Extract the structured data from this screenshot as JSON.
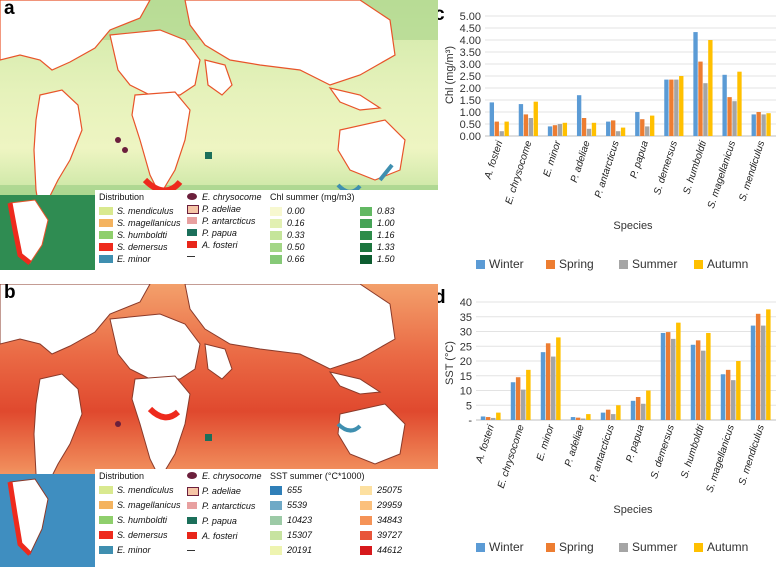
{
  "panels": {
    "a": "a",
    "b": "b",
    "c": "c",
    "d": "d"
  },
  "legend_a": {
    "distribution_title": "Distribution",
    "distribution": [
      {
        "label": "S. mendiculus",
        "color": "#d9e98f"
      },
      {
        "label": "S. magellanicus",
        "color": "#f4b35f"
      },
      {
        "label": "S. humboldti",
        "color": "#8fcf6c"
      },
      {
        "label": "S. demersus",
        "color": "#ee2a1d"
      },
      {
        "label": "E. minor",
        "color": "#3f8fb0"
      }
    ],
    "species2": [
      {
        "label": "E. chrysocome",
        "color": "#6b1f3c"
      },
      {
        "label": "P. adeliae",
        "color": "#f6c5a6"
      },
      {
        "label": "P. antarcticus",
        "color": "#e8a0a0"
      },
      {
        "label": "P. papua",
        "color": "#1b6f5a"
      },
      {
        "label": "A. fosteri",
        "color": "#e8261a"
      },
      {
        "label": "",
        "color": "#333333"
      }
    ],
    "scale_title": "Chl summer (mg/m3)",
    "scale": [
      {
        "label": "0.00",
        "color": "#f7f8d0"
      },
      {
        "label": "0.16",
        "color": "#e2f0b2"
      },
      {
        "label": "0.33",
        "color": "#c5e59a"
      },
      {
        "label": "0.50",
        "color": "#a3d686"
      },
      {
        "label": "0.66",
        "color": "#86c977"
      },
      {
        "label": "0.83",
        "color": "#62b863"
      },
      {
        "label": "1.00",
        "color": "#45a356"
      },
      {
        "label": "1.16",
        "color": "#2e8c4a"
      },
      {
        "label": "1.33",
        "color": "#1d763f"
      },
      {
        "label": "1.50",
        "color": "#0d5c30"
      }
    ]
  },
  "legend_b": {
    "distribution_title": "Distribution",
    "distribution": [
      {
        "label": "S. mendiculus",
        "color": "#d9e98f"
      },
      {
        "label": "S. magellanicus",
        "color": "#f4b35f"
      },
      {
        "label": "S. humboldti",
        "color": "#8fcf6c"
      },
      {
        "label": "S. demersus",
        "color": "#ee2a1d"
      },
      {
        "label": "E. minor",
        "color": "#3f8fb0"
      }
    ],
    "species2": [
      {
        "label": "E. chrysocome",
        "color": "#6b1f3c"
      },
      {
        "label": "P. adeliae",
        "color": "#f6c5a6"
      },
      {
        "label": "P. antarcticus",
        "color": "#e8a0a0"
      },
      {
        "label": "P. papua",
        "color": "#1b6f5a"
      },
      {
        "label": "A. fosteri",
        "color": "#e8261a"
      },
      {
        "label": "",
        "color": "#333333"
      }
    ],
    "scale_title": "SST summer (°C*1000)",
    "scale": [
      {
        "label": "655",
        "color": "#2f7fb8"
      },
      {
        "label": "5539",
        "color": "#6fa9c6"
      },
      {
        "label": "10423",
        "color": "#9ccaa6"
      },
      {
        "label": "15307",
        "color": "#c7e3a0"
      },
      {
        "label": "20191",
        "color": "#eef4b0"
      },
      {
        "label": "25075",
        "color": "#fde0a0"
      },
      {
        "label": "29959",
        "color": "#fbc07c"
      },
      {
        "label": "34843",
        "color": "#f59357"
      },
      {
        "label": "39727",
        "color": "#e8553a"
      },
      {
        "label": "44612",
        "color": "#d7191c"
      }
    ]
  },
  "colors": {
    "Winter": "#5b9bd5",
    "Spring": "#ed7d31",
    "Summer": "#a5a5a5",
    "Autumn": "#ffc000"
  },
  "chart_data": [
    {
      "type": "bar",
      "title": "",
      "xlabel": "Species",
      "ylabel": "Chl (mg/m³)",
      "ylim": [
        0,
        5
      ],
      "yticks": [
        "0.00",
        "0.50",
        "1.00",
        "1.50",
        "2.00",
        "2.50",
        "3.00",
        "3.50",
        "4.00",
        "4.50",
        "5.00"
      ],
      "categories": [
        "A. fosteri",
        "E. chrysocome",
        "E. minor",
        "P. adeliae",
        "P. antarcticus",
        "P. papua",
        "S. demersus",
        "S. humboldti",
        "S. magellanicus",
        "S. mendiculus"
      ],
      "series": [
        {
          "name": "Winter",
          "values": [
            1.4,
            1.33,
            0.4,
            1.7,
            0.6,
            1.0,
            2.35,
            4.33,
            2.55,
            0.9
          ]
        },
        {
          "name": "Spring",
          "values": [
            0.6,
            0.9,
            0.45,
            0.75,
            0.65,
            0.7,
            2.35,
            3.1,
            1.62,
            1.0
          ]
        },
        {
          "name": "Summer",
          "values": [
            0.2,
            0.75,
            0.5,
            0.3,
            0.2,
            0.4,
            2.35,
            2.2,
            1.45,
            0.9
          ]
        },
        {
          "name": "Autumn",
          "values": [
            0.6,
            1.43,
            0.55,
            0.55,
            0.35,
            0.85,
            2.5,
            4.0,
            2.68,
            0.95
          ]
        }
      ],
      "legend": "bottom",
      "grid": true
    },
    {
      "type": "bar",
      "title": "",
      "xlabel": "Species",
      "ylabel": "SST (°C)",
      "ylim": [
        0,
        40
      ],
      "yticks": [
        "-",
        "5",
        "10",
        "15",
        "20",
        "25",
        "30",
        "35",
        "40"
      ],
      "categories": [
        "A. fosteri",
        "E. chrysocome",
        "E. minor",
        "P. adeliae",
        "P. antarcticus",
        "P. papua",
        "S. demersus",
        "S. humboldti",
        "S. magellanicus",
        "S. mendiculus"
      ],
      "series": [
        {
          "name": "Winter",
          "values": [
            1.2,
            12.8,
            23.0,
            1.0,
            2.5,
            6.5,
            29.5,
            25.5,
            15.5,
            32.0
          ]
        },
        {
          "name": "Spring",
          "values": [
            1.0,
            14.5,
            26.0,
            0.8,
            3.5,
            7.8,
            29.8,
            27.0,
            17.0,
            36.0
          ]
        },
        {
          "name": "Summer",
          "values": [
            0.7,
            10.3,
            21.5,
            0.5,
            2.0,
            5.5,
            27.5,
            23.5,
            13.5,
            32.0
          ]
        },
        {
          "name": "Autumn",
          "values": [
            2.5,
            17.0,
            28.0,
            2.0,
            5.0,
            10.0,
            33.0,
            29.5,
            20.0,
            37.5
          ]
        }
      ],
      "legend": "bottom",
      "grid": true
    }
  ]
}
